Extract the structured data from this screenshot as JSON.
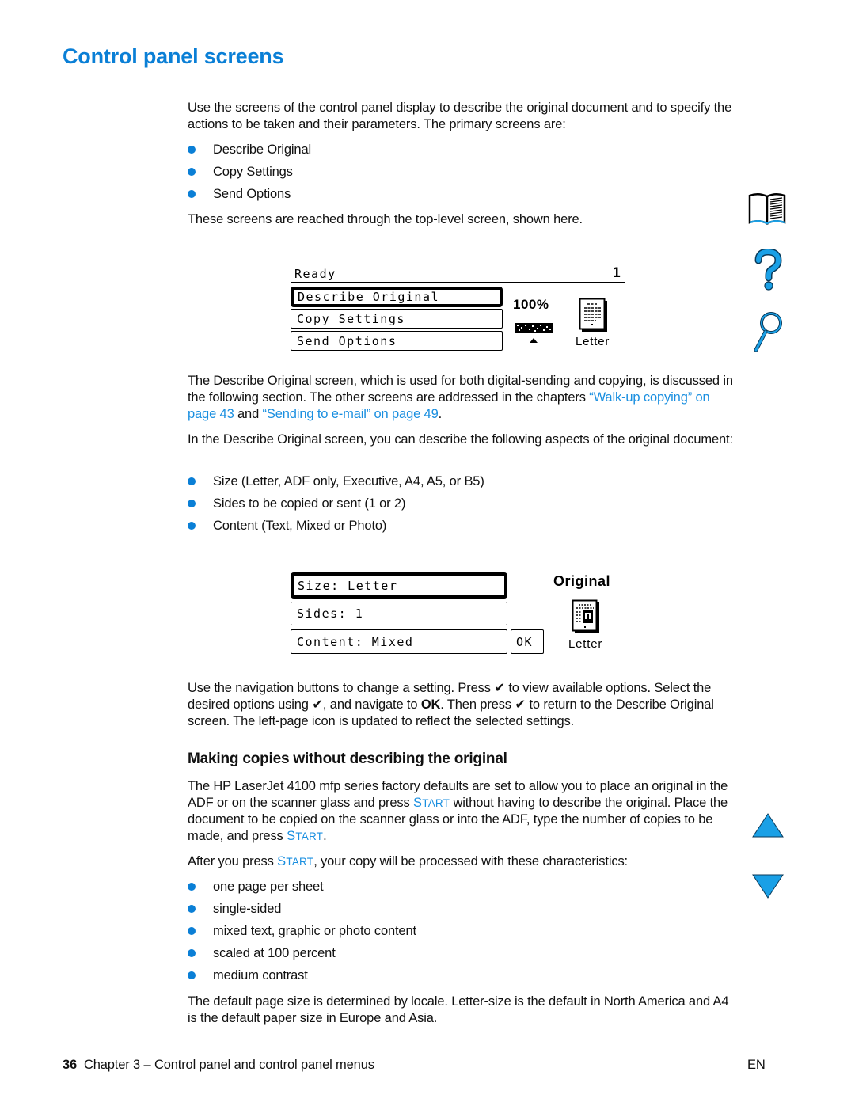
{
  "page_title": "Control panel screens",
  "intro": {
    "text": "Use the screens of the control panel display to describe the original document and to specify the actions to be taken and their parameters. The primary screens are:",
    "bullets": [
      "Describe Original",
      "Copy Settings",
      "Send Options"
    ],
    "after": "These screens are reached through the top-level screen, shown here."
  },
  "lcd_top": {
    "status": "Ready",
    "copies": "1",
    "menu": [
      "Describe Original",
      "Copy Settings",
      "Send Options"
    ],
    "selected_index": 0,
    "scale": "100%",
    "paper_label": "Letter",
    "icons": [
      "contrast-bar-icon",
      "contrast-pointer-icon",
      "text-page-icon"
    ]
  },
  "describe_section": {
    "para1_prefix": "The Describe Original screen, which is used for both digital-sending and copying, is discussed in the following section. The other screens are addressed in the chapters ",
    "link1": "“Walk-up copying” on page 43",
    "para1_mid": " and ",
    "link2": "“Sending to e-mail” on page 49",
    "para1_suffix": ".",
    "para2": "In the Describe Original screen, you can describe the following aspects of the original document:",
    "bullets": [
      "Size (Letter, ADF only, Executive, A4, A5, or B5)",
      "Sides to be copied or sent (1 or 2)",
      "Content (Text, Mixed or Photo)"
    ]
  },
  "lcd_describe": {
    "fields": [
      "Size: Letter",
      "Sides: 1",
      "Content: Mixed"
    ],
    "selected_index": 0,
    "ok_label": "OK",
    "heading": "Original",
    "paper_label": "Letter",
    "icons": [
      "mixed-page-icon"
    ]
  },
  "nav_para": {
    "p1": "Use the navigation buttons to change a setting. Press ",
    "p2": " to view available options. Select the desired options using ",
    "p3": ", and navigate to ",
    "ok": "OK",
    "p4": ". Then press ",
    "p5": " to return to the Describe Original screen. The left-page icon is updated to reflect the selected settings.",
    "check_glyph": "✔"
  },
  "section2": {
    "heading": "Making copies without describing the original",
    "para1_a": "The HP LaserJet 4100 mfp series factory defaults are set to allow you to place an original in the ADF or on the scanner glass and press ",
    "start_cap": "S",
    "start_rest": "TART",
    "para1_b": " without having to describe the original. Place the document to be copied on the scanner glass or into the ADF, type the number of copies to be made, and press ",
    "para1_c": ".",
    "para2_a": "After you press ",
    "para2_b": ", your copy will be processed with these characteristics:",
    "bullets": [
      "one page per sheet",
      "single-sided",
      "mixed text, graphic or photo content",
      "scaled at 100 percent",
      "medium contrast"
    ],
    "para3": "The default page size is determined by locale. Letter-size is the default in North America and A4 is the default paper size in Europe and Asia."
  },
  "side_nav": {
    "contents": "book-icon",
    "help": "question-icon",
    "index": "magnifier-icon",
    "prev": "previous-page-icon",
    "next": "next-page-icon"
  },
  "footer": {
    "page_number": "36",
    "chapter": "Chapter 3 – Control panel and control panel menus",
    "language": "EN"
  },
  "colors": {
    "accent": "#0a7fd6",
    "link": "#1a8fe0",
    "nav_arrow": "#1aa0e6",
    "text": "#111111"
  }
}
